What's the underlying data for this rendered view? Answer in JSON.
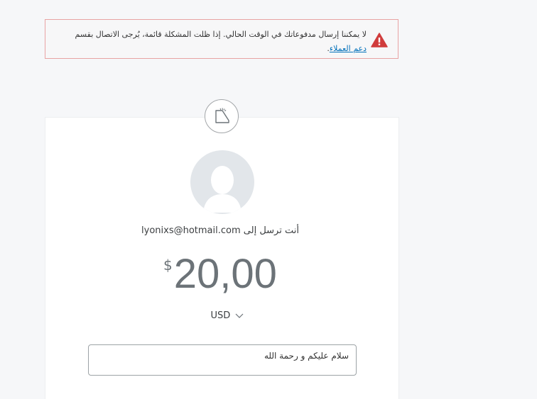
{
  "alert": {
    "message": "لا يمكننا إرسال مدفوعاتك في الوقت الحالي. إذا ظلت المشكلة قائمة، يُرجى الاتصال بقسم ",
    "link_text": "دعم العملاء",
    "suffix": ".",
    "icon": "warning-triangle-icon",
    "border_color": "#e8a3a3",
    "icon_color": "#d03c3c"
  },
  "send": {
    "recipient_text": "أنت ترسل إلى lyonixs@hotmail.com",
    "currency_symbol": "$",
    "amount": "20,00",
    "currency_code": "USD",
    "note_value": "سلام عليكم و رحمة الله"
  },
  "colors": {
    "link": "#0070ba",
    "amount": "#6c7378",
    "avatar_bg": "#e2e6ea"
  }
}
